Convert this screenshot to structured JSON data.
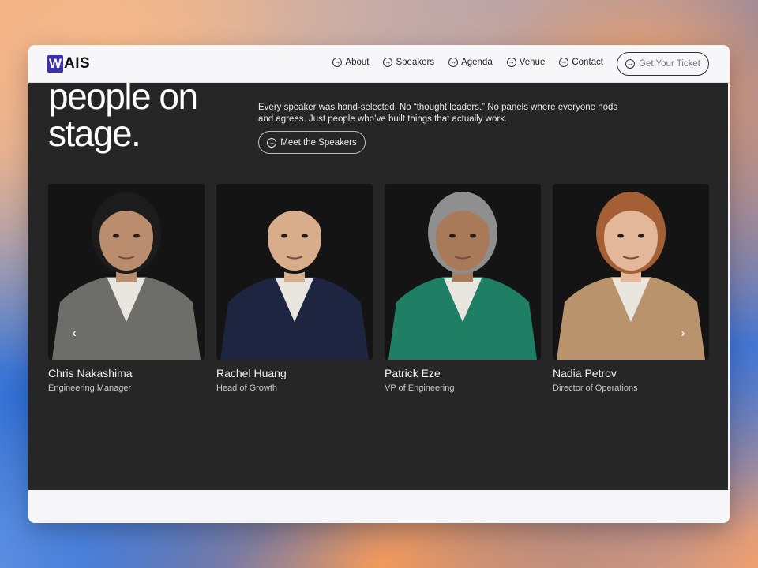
{
  "logo": {
    "mark": "W",
    "text": "AIS"
  },
  "nav": {
    "links": [
      {
        "label": "About"
      },
      {
        "label": "Speakers"
      },
      {
        "label": "Agenda"
      },
      {
        "label": "Venue"
      },
      {
        "label": "Contact"
      }
    ],
    "cta_label": "Get Your Ticket"
  },
  "hero": {
    "title": "people on\nstage.",
    "description": "Every speaker was hand-selected. No “thought leaders.” No panels where everyone nods and agrees. Just people who’ve built things that actually work.",
    "button_label": "Meet the Speakers"
  },
  "speakers": [
    {
      "name": "Chris Nakashima",
      "role": "Engineering Manager",
      "jacket": "#6d6d6a",
      "hair": "#1c1c1c",
      "skin": "#b98d6e"
    },
    {
      "name": "Rachel Huang",
      "role": "Head of Growth",
      "jacket": "#1d2540",
      "hair": "#141414",
      "skin": "#d7ad8c"
    },
    {
      "name": "Patrick Eze",
      "role": "VP of Engineering",
      "jacket": "#1f7f65",
      "hair": "#8f8f8f",
      "skin": "#a97a5a"
    },
    {
      "name": "Nadia Petrov",
      "role": "Director of Operations",
      "jacket": "#b8936b",
      "hair": "#a55f34",
      "skin": "#e2b79a"
    }
  ],
  "carousel": {
    "prev_icon": "chevron-left-icon",
    "next_icon": "chevron-right-icon"
  }
}
